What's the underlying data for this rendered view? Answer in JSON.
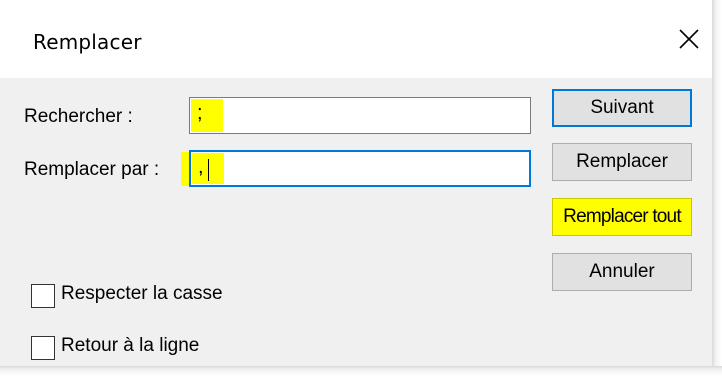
{
  "window": {
    "title": "Remplacer",
    "close_icon": "close-icon"
  },
  "search": {
    "label": "Rechercher :",
    "value": ";"
  },
  "replace": {
    "label": "Remplacer par :",
    "value": ","
  },
  "buttons": {
    "next": "Suivant",
    "replace": "Remplacer",
    "replace_all": "Remplacer tout",
    "cancel": "Annuler"
  },
  "options": {
    "match_case": {
      "label": "Respecter la casse",
      "checked": false
    },
    "wrap_around": {
      "label": "Retour à la ligne",
      "checked": false
    }
  },
  "colors": {
    "highlight": "#ffff00",
    "focus_border": "#0078d7",
    "client_background": "#f0f0f0"
  }
}
